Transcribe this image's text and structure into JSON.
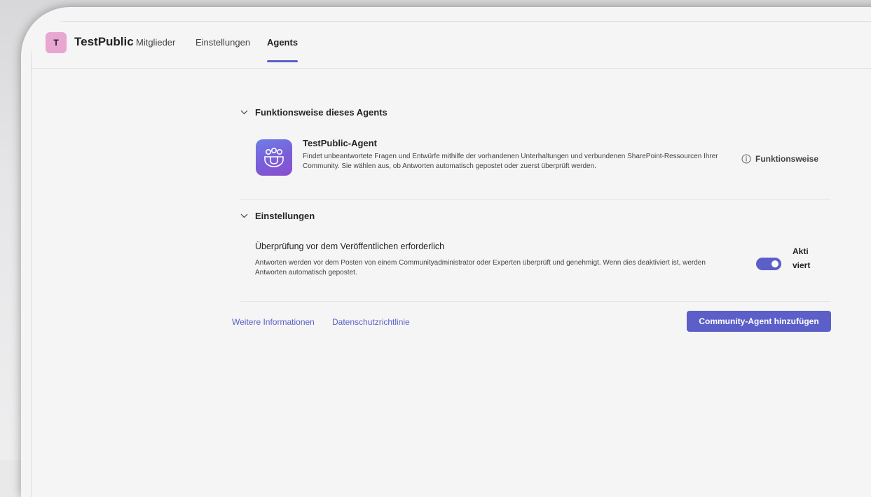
{
  "team": {
    "avatar_letter": "T",
    "name": "TestPublic",
    "avatar_color": "#e8a6d1"
  },
  "tabs": [
    {
      "label": "Mitglieder",
      "active": false
    },
    {
      "label": "Einstellungen",
      "active": false
    },
    {
      "label": "Agents",
      "active": true
    }
  ],
  "section_how": {
    "title": "Funktionsweise dieses Agents",
    "agent_name": "TestPublic-Agent",
    "agent_description": "Findet unbeantwortete Fragen und Entwürfe mithilfe der vorhandenen Unterhaltungen und verbundenen SharePoint-Ressourcen Ihrer Community. Sie wählen aus, ob Antworten automatisch gepostet oder zuerst überprüft werden.",
    "info_link_label": "Funktionsweise",
    "icon": "community-agent-icon"
  },
  "section_settings": {
    "title": "Einstellungen",
    "setting_title": "Überprüfung vor dem Veröffentlichen erforderlich",
    "setting_description": "Antworten werden vor dem Posten von einem Communityadministrator oder Experten überprüft und genehmigt. Wenn dies deaktiviert ist, werden Antworten automatisch gepostet.",
    "toggle_on": true,
    "toggle_label": "Aktiviert"
  },
  "footer": {
    "more_info_label": "Weitere Informationen",
    "privacy_label": "Datenschutzrichtlinie",
    "add_button_label": "Community-Agent hinzufügen"
  },
  "colors": {
    "accent": "#5b5fc7"
  }
}
